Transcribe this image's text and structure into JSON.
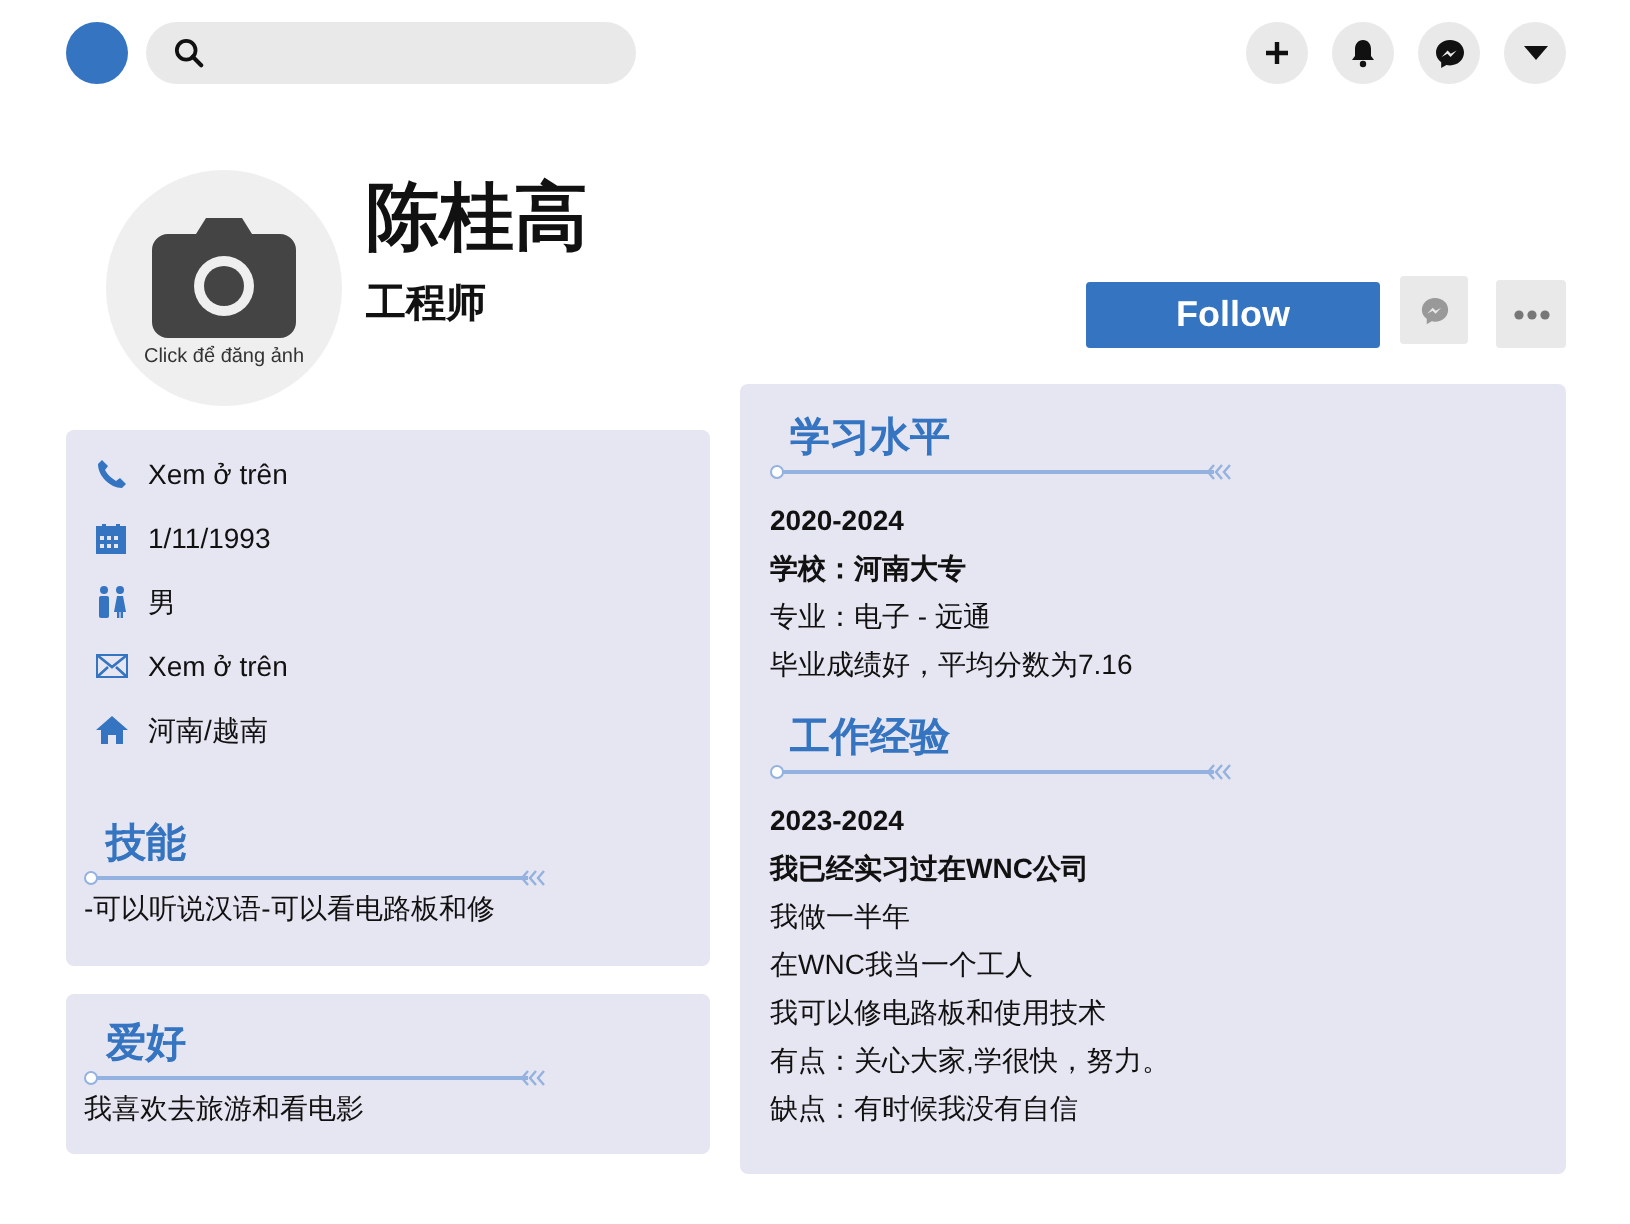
{
  "profile": {
    "name": "陈桂高",
    "title": "工程师",
    "avatar_caption": "Click để đăng ảnh"
  },
  "actions": {
    "follow": "Follow"
  },
  "contact": [
    {
      "kind": "phone",
      "text": "Xem ở trên"
    },
    {
      "kind": "calendar",
      "text": "1/11/1993"
    },
    {
      "kind": "gender",
      "text": "男"
    },
    {
      "kind": "mail",
      "text": "Xem ở trên"
    },
    {
      "kind": "home",
      "text": "河南/越南"
    }
  ],
  "skills": {
    "title": "技能",
    "text": "-可以听说汉语-可以看电路板和修"
  },
  "hobbies": {
    "title": "爱好",
    "text": "我喜欢去旅游和看电影"
  },
  "sections": [
    {
      "title": "学习水平",
      "lines": [
        {
          "text": "2020-2024",
          "bold": true
        },
        {
          "text": "学校：河南大专",
          "bold": true
        },
        {
          "text": "专业：电子 - 远通",
          "bold": false
        },
        {
          "text": "毕业成绩好，平均分数为7.16",
          "bold": false
        }
      ]
    },
    {
      "title": "工作经验",
      "lines": [
        {
          "text": "2023-2024",
          "bold": true
        },
        {
          "text": "我已经实习过在WNC公司",
          "bold": true
        },
        {
          "text": "我做一半年",
          "bold": false
        },
        {
          "text": "在WNC我当一个工人",
          "bold": false
        },
        {
          "text": "我可以修电路板和使用技术",
          "bold": false
        },
        {
          "text": "有点：关心大家,学很快，努力。",
          "bold": false
        },
        {
          "text": "缺点：有时候我没有自信",
          "bold": false
        }
      ]
    }
  ]
}
